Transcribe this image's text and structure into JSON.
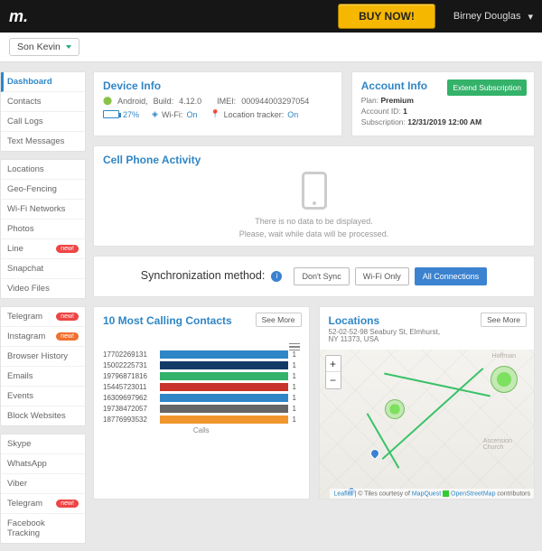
{
  "topbar": {
    "buy_label": "BUY NOW!",
    "user_name": "Birney Douglas"
  },
  "target": {
    "selected": "Son Kevin"
  },
  "sidebar": {
    "groups": [
      {
        "items": [
          {
            "label": "Dashboard",
            "active": true
          },
          {
            "label": "Contacts"
          },
          {
            "label": "Call Logs"
          },
          {
            "label": "Text Messages"
          }
        ]
      },
      {
        "items": [
          {
            "label": "Locations"
          },
          {
            "label": "Geo-Fencing"
          },
          {
            "label": "Wi-Fi Networks"
          },
          {
            "label": "Photos"
          },
          {
            "label": "Line",
            "badge": "new!",
            "badge_color": "red"
          },
          {
            "label": "Snapchat"
          },
          {
            "label": "Video Files"
          }
        ]
      },
      {
        "items": [
          {
            "label": "Telegram",
            "badge": "new!",
            "badge_color": "red"
          },
          {
            "label": "Instagram",
            "badge": "new!",
            "badge_color": "orange"
          },
          {
            "label": "Browser History"
          },
          {
            "label": "Emails"
          },
          {
            "label": "Events"
          },
          {
            "label": "Block Websites"
          }
        ]
      },
      {
        "items": [
          {
            "label": "Skype"
          },
          {
            "label": "WhatsApp"
          },
          {
            "label": "Viber"
          },
          {
            "label": "Telegram",
            "badge": "new!",
            "badge_color": "red"
          },
          {
            "label": "Facebook Tracking"
          }
        ]
      }
    ]
  },
  "device": {
    "title": "Device Info",
    "platform": "Android,",
    "build_label": "Build:",
    "build": "4.12.0",
    "imei_label": "IMEI:",
    "imei": "000944003297054",
    "battery": "27%",
    "wifi_label": "Wi-Fi:",
    "wifi": "On",
    "loc_label": "Location tracker:",
    "loc": "On"
  },
  "account": {
    "title": "Account Info",
    "plan_label": "Plan:",
    "plan": "Premium",
    "acct_label": "Account ID:",
    "acct": "1",
    "sub_label": "Subscription:",
    "sub": "12/31/2019 12:00 AM",
    "extend": "Extend Subscription"
  },
  "activity": {
    "title": "Cell Phone Activity",
    "msg1": "There is no data to be displayed.",
    "msg2": "Please, wait while data will be processed."
  },
  "sync": {
    "label": "Synchronization method:",
    "opts": [
      "Don't Sync",
      "Wi-Fi Only",
      "All Connections"
    ],
    "active": 2
  },
  "calls": {
    "title": "10 Most Calling Contacts",
    "see_more": "See More",
    "x_label": "Calls"
  },
  "chart_data": {
    "type": "bar",
    "orientation": "horizontal",
    "categories": [
      "17702269131",
      "15002225731",
      "19796871816",
      "15445723011",
      "16309697962",
      "19738472057",
      "18776993532"
    ],
    "values": [
      1,
      1,
      1,
      1,
      1,
      1,
      1
    ],
    "colors": [
      "#2f86c6",
      "#123a66",
      "#34b26a",
      "#c8342b",
      "#2f86c6",
      "#666666",
      "#f0962c"
    ],
    "xlabel": "Calls",
    "title": "10 Most Calling Contacts",
    "xlim": [
      0,
      1
    ]
  },
  "locations": {
    "title": "Locations",
    "address_l1": "52-02-52-98 Seabury St, Elmhurst,",
    "address_l2": "NY 11373, USA",
    "see_more": "See More",
    "attrib_leaflet": "Leaflet",
    "attrib_mid": " | © Tiles courtesy of ",
    "attrib_mq": "MapQuest",
    "attrib_osm": "OpenStreetMap",
    "attrib_tail": " contributors"
  }
}
